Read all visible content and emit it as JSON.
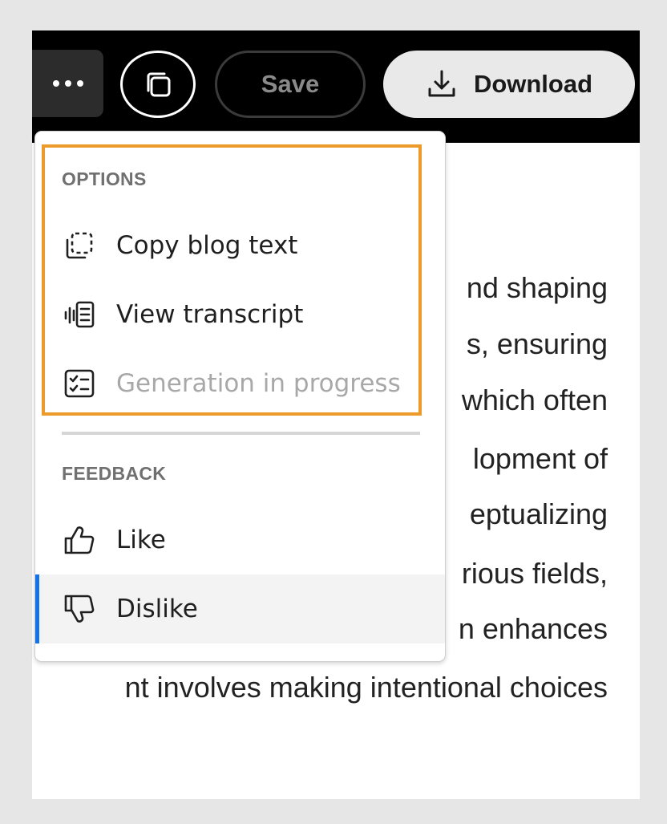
{
  "toolbar": {
    "more_label": "More options",
    "save_label": "Save",
    "download_label": "Download"
  },
  "background_text": {
    "lines": [
      "nd shaping",
      "s, ensuring",
      "which often",
      "lopment of",
      "eptualizing",
      "rious fields,",
      "n enhances",
      "nt involves making intentional choices"
    ]
  },
  "menu": {
    "options_heading": "OPTIONS",
    "options_items": [
      {
        "label": "Copy blog text",
        "icon": "copy-dashed-icon",
        "disabled": false
      },
      {
        "label": "View transcript",
        "icon": "transcript-icon",
        "disabled": false
      },
      {
        "label": "Generation in progress",
        "icon": "checklist-icon",
        "disabled": true
      }
    ],
    "feedback_heading": "FEEDBACK",
    "feedback_items": [
      {
        "label": "Like",
        "icon": "thumbs-up-icon"
      },
      {
        "label": "Dislike",
        "icon": "thumbs-down-icon"
      }
    ]
  },
  "colors": {
    "highlight": "#ec9a29",
    "focus_accent": "#1473e6",
    "toolbar_bg": "#000000"
  }
}
